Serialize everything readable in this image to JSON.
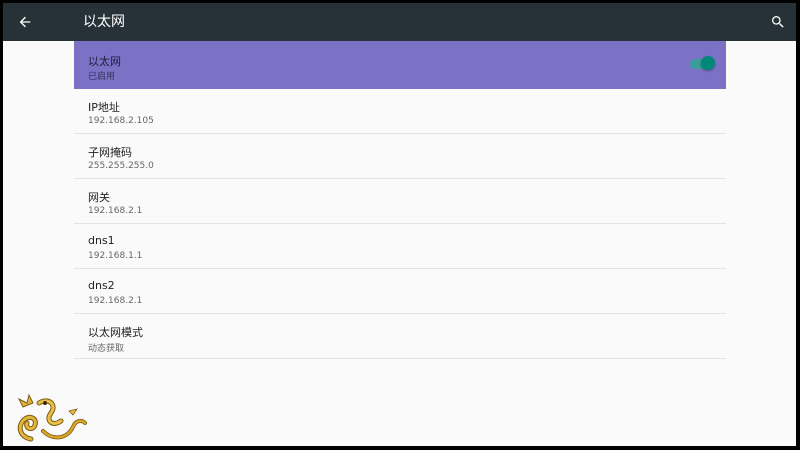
{
  "header": {
    "back_icon": "arrow-back-icon",
    "title": "以太网",
    "search_icon": "search-icon",
    "background": "#263238"
  },
  "ethernet": {
    "label": "以太网",
    "status": "已启用",
    "enabled": true,
    "highlight_color": "#7b72c6",
    "switch_color": "#00897b"
  },
  "settings": [
    {
      "label": "IP地址",
      "value": "192.168.2.105"
    },
    {
      "label": "子网掩码",
      "value": "255.255.255.0"
    },
    {
      "label": "网关",
      "value": "192.168.2.1"
    },
    {
      "label": "dns1",
      "value": "192.168.1.1"
    },
    {
      "label": "dns2",
      "value": "192.168.2.1"
    },
    {
      "label": "以太网模式",
      "value": "动态获取"
    }
  ]
}
